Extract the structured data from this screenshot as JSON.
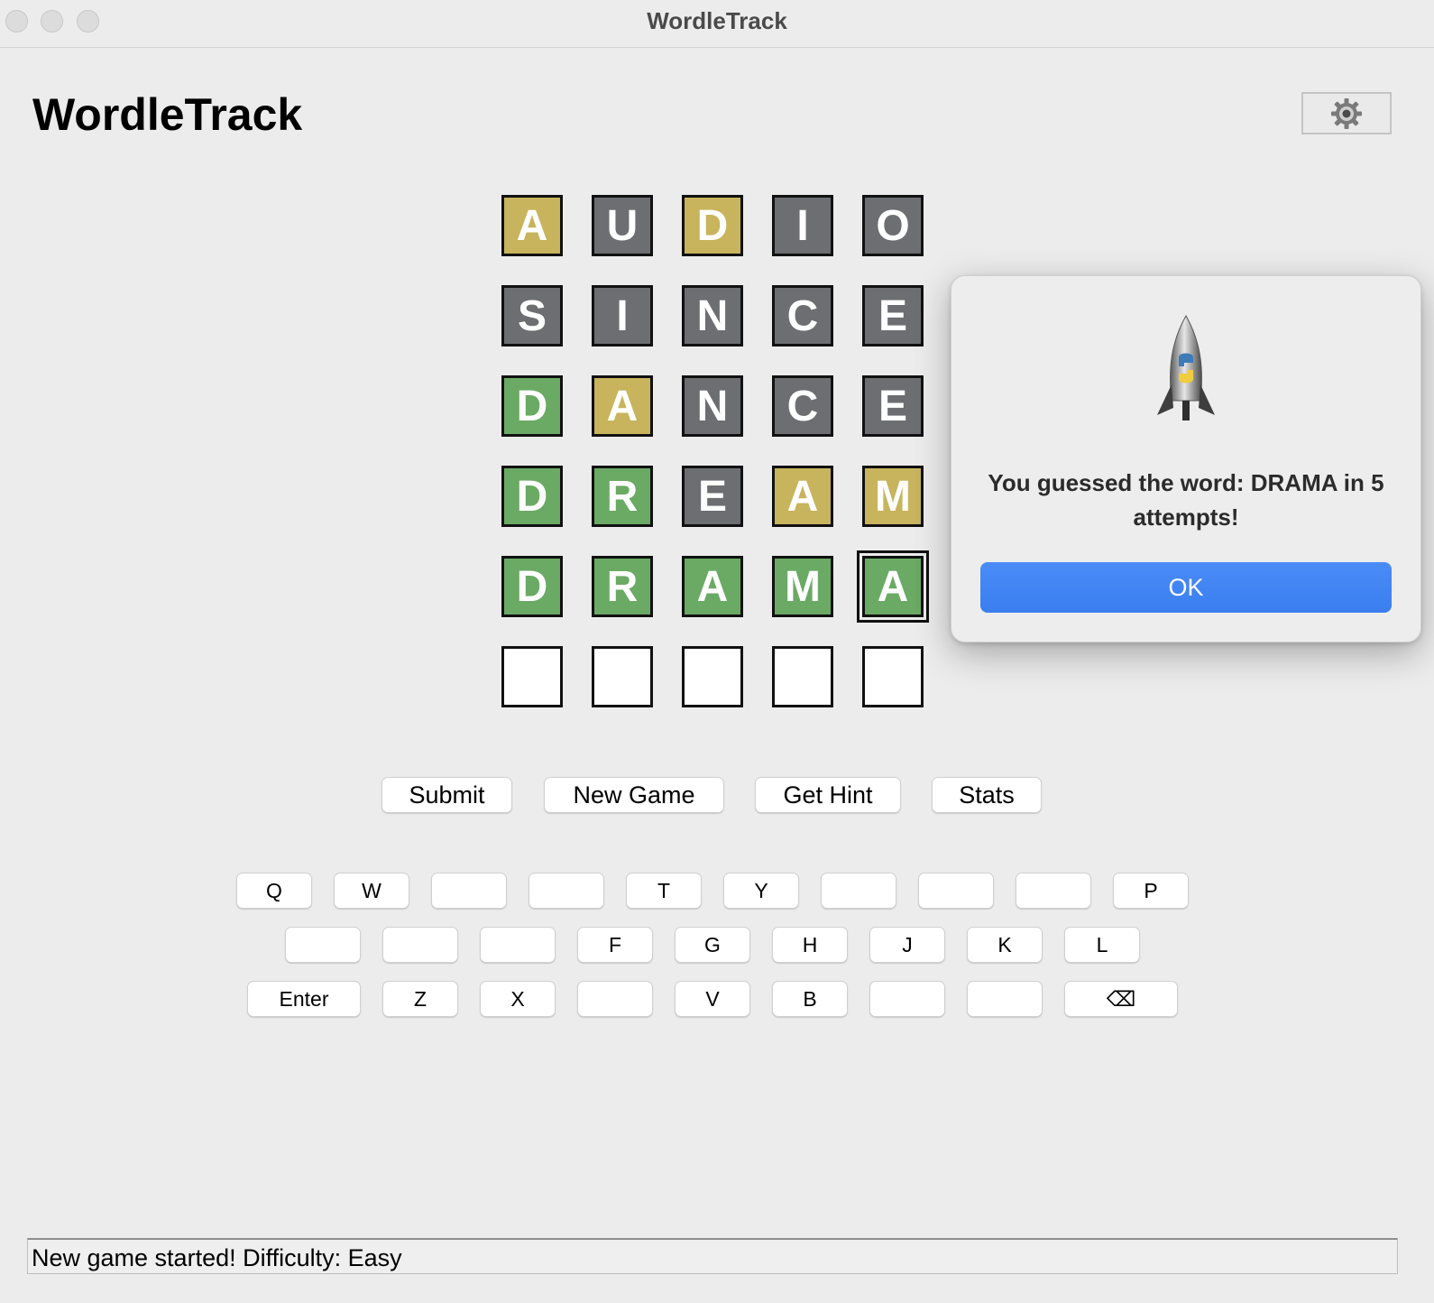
{
  "window": {
    "title": "WordleTrack"
  },
  "header": {
    "app_title": "WordleTrack",
    "settings_icon": "gear-icon"
  },
  "board": [
    [
      {
        "letter": "A",
        "state": "present"
      },
      {
        "letter": "U",
        "state": "absent"
      },
      {
        "letter": "D",
        "state": "present"
      },
      {
        "letter": "I",
        "state": "absent"
      },
      {
        "letter": "O",
        "state": "absent"
      }
    ],
    [
      {
        "letter": "S",
        "state": "absent"
      },
      {
        "letter": "I",
        "state": "absent"
      },
      {
        "letter": "N",
        "state": "absent"
      },
      {
        "letter": "C",
        "state": "absent"
      },
      {
        "letter": "E",
        "state": "absent"
      }
    ],
    [
      {
        "letter": "D",
        "state": "correct"
      },
      {
        "letter": "A",
        "state": "present"
      },
      {
        "letter": "N",
        "state": "absent"
      },
      {
        "letter": "C",
        "state": "absent"
      },
      {
        "letter": "E",
        "state": "absent"
      }
    ],
    [
      {
        "letter": "D",
        "state": "correct"
      },
      {
        "letter": "R",
        "state": "correct"
      },
      {
        "letter": "E",
        "state": "absent"
      },
      {
        "letter": "A",
        "state": "present"
      },
      {
        "letter": "M",
        "state": "present"
      }
    ],
    [
      {
        "letter": "D",
        "state": "correct"
      },
      {
        "letter": "R",
        "state": "correct"
      },
      {
        "letter": "A",
        "state": "correct"
      },
      {
        "letter": "M",
        "state": "correct"
      },
      {
        "letter": "A",
        "state": "correct"
      }
    ],
    [
      {
        "letter": "",
        "state": "empty"
      },
      {
        "letter": "",
        "state": "empty"
      },
      {
        "letter": "",
        "state": "empty"
      },
      {
        "letter": "",
        "state": "empty"
      },
      {
        "letter": "",
        "state": "empty"
      }
    ]
  ],
  "colors": {
    "absent": "#6c6e72",
    "present": "#c7b45c",
    "correct": "#6aaa64",
    "empty": "#ffffff",
    "ok_button": "#3a7ef0"
  },
  "actions": {
    "submit": "Submit",
    "new_game": "New Game",
    "get_hint": "Get Hint",
    "stats": "Stats"
  },
  "keyboard": {
    "row1": [
      "Q",
      "W",
      "",
      "",
      "T",
      "Y",
      "",
      "",
      "",
      "P"
    ],
    "row2": [
      "",
      "",
      "",
      "F",
      "G",
      "H",
      "J",
      "K",
      "L"
    ],
    "row3": [
      "Enter",
      "Z",
      "X",
      "",
      "V",
      "B",
      "",
      "",
      "⌫"
    ]
  },
  "status": {
    "message": "New game started! Difficulty: Easy"
  },
  "dialog": {
    "icon": "python-launcher-rocket-icon",
    "message": "You guessed the word: DRAMA in 5 attempts!",
    "ok_label": "OK"
  }
}
